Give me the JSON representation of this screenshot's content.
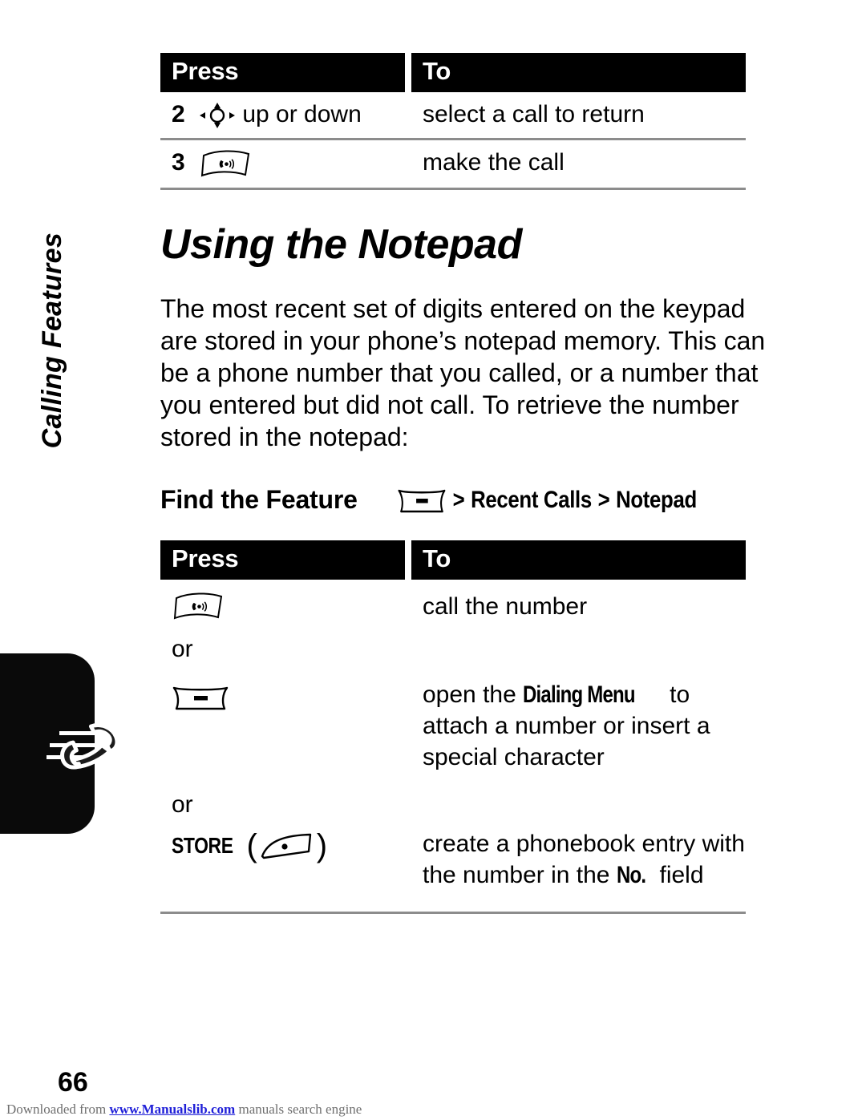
{
  "page": {
    "number": "66",
    "running_head": "Calling Features"
  },
  "table_top": {
    "headers": {
      "press": "Press",
      "to": "To"
    },
    "rows": [
      {
        "step": "2",
        "icon": "nav-key-icon",
        "press_text": "up or down",
        "to": "select a call to return"
      },
      {
        "step": "3",
        "icon": "send-key-icon",
        "press_text": "",
        "to": "make the call"
      }
    ]
  },
  "section": {
    "title": "Using the Notepad",
    "body": "The most recent set of digits entered on the keypad are stored in your phone’s notepad memory. This can be a phone number that you called, or a number that you entered but did not call. To retrieve the number stored in the notepad:"
  },
  "find_the_feature": {
    "label": "Find the Feature",
    "icon": "menu-key-icon",
    "separator_1": ">",
    "path_1": "Recent Calls",
    "separator_2": ">",
    "path_2": "Notepad"
  },
  "table_bottom": {
    "headers": {
      "press": "Press",
      "to": "To"
    },
    "rows": [
      {
        "icon": "send-key-icon",
        "press_text": "",
        "to": "call the number"
      },
      {
        "or": "or"
      },
      {
        "icon": "menu-key-icon",
        "press_text": "",
        "to_prefix": "open the ",
        "to_bold": "Dialing Menu",
        "to_suffix": " to attach a number or insert a special character"
      },
      {
        "or": "or"
      },
      {
        "icon": "softkey-icon",
        "press_text": "STORE",
        "to_prefix": "create a phonebook entry with the number in the ",
        "to_bold": "No.",
        "to_suffix": " field"
      }
    ]
  },
  "footer": {
    "prefix": "Downloaded from ",
    "link": "www.Manualslib.com",
    "suffix": " manuals search engine"
  },
  "colors": {
    "header_bg": "#000000",
    "rule": "#8c8c8c",
    "link": "#2020d8",
    "footer_text": "#6f6f6f"
  }
}
